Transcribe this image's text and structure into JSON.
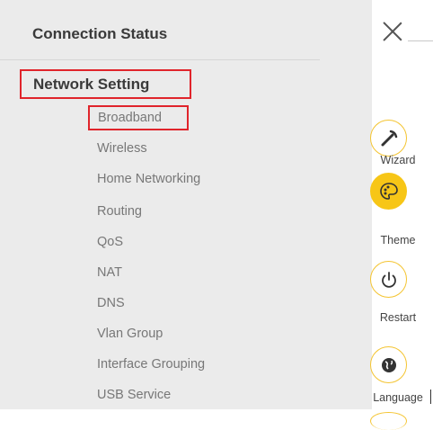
{
  "menu": {
    "connection_status": "Connection Status",
    "network_setting": "Network Setting",
    "items": [
      {
        "label": "Broadband",
        "highlighted": true
      },
      {
        "label": "Wireless"
      },
      {
        "label": "Home Networking"
      },
      {
        "label": "Routing"
      },
      {
        "label": "QoS"
      },
      {
        "label": "NAT"
      },
      {
        "label": "DNS"
      },
      {
        "label": "Vlan Group"
      },
      {
        "label": "Interface Grouping"
      },
      {
        "label": "USB Service"
      }
    ]
  },
  "close_icon": "close-icon",
  "toolbar": [
    {
      "label": "Wizard",
      "icon": "wizard-wand-icon"
    },
    {
      "label": "Theme",
      "icon": "palette-icon",
      "active": true
    },
    {
      "label": "Restart",
      "icon": "power-icon"
    },
    {
      "label": "Language",
      "icon": "globe-icon"
    }
  ],
  "colors": {
    "highlight_border": "#e0242b",
    "accent_yellow": "#f7c617",
    "panel_bg": "#ebebeb",
    "text_dark": "#3a3a3a",
    "text_muted": "#777777"
  }
}
